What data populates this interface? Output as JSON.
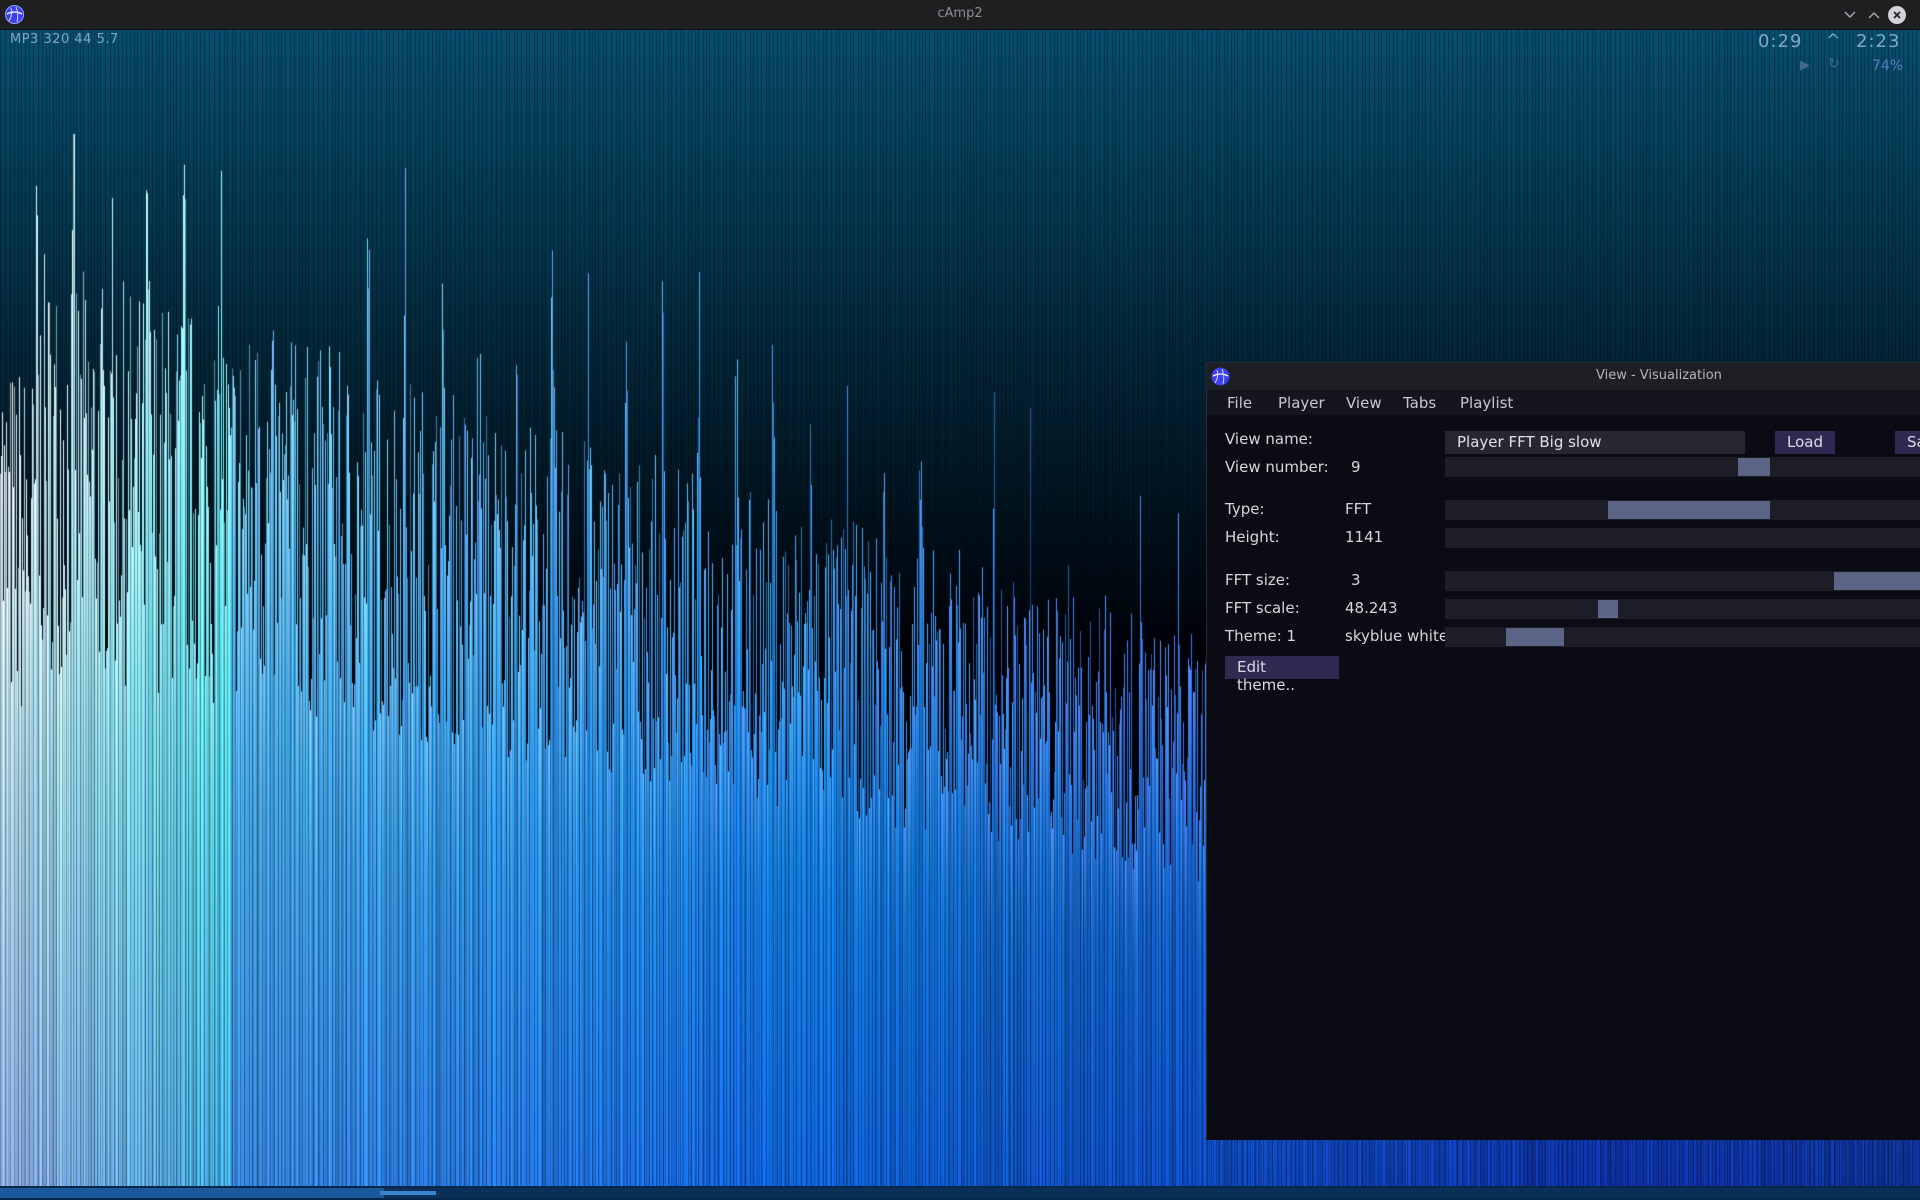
{
  "window": {
    "title": "cAmp2",
    "controls": {
      "minimize": "chevron-down",
      "maximize": "chevron-up",
      "close": "close-x"
    }
  },
  "player": {
    "format_info": "MP3 320 44  5.7",
    "time_current": "0:29",
    "time_separator": "^",
    "time_total": "2:23",
    "volume": "74%",
    "playback_progress": 0.2,
    "icons": {
      "play": "play-icon",
      "repeat": "repeat-icon"
    }
  },
  "visualization": {
    "type": "FFT spectrum",
    "colors": {
      "bright": "#e8ffff",
      "mid": "#2f9ef2",
      "dark": "#0a3f9e",
      "bg_top": "#07506f",
      "bg_bottom": "#000005"
    }
  },
  "view_window": {
    "title": "View - Visualization",
    "menu": [
      "File",
      "Player",
      "View",
      "Tabs",
      "Playlist"
    ],
    "fields": {
      "view_name_label": "View name:",
      "view_name_value": "Player FFT Big slow",
      "load_label": "Load",
      "save_label": "Sa",
      "view_number_label": "View number:",
      "view_number_value": "9",
      "type_label": "Type:",
      "type_value": "FFT",
      "height_label": "Height:",
      "height_value": "1141",
      "fft_size_label": "FFT size:",
      "fft_size_value": "3",
      "fft_scale_label": "FFT scale:",
      "fft_scale_value": "48.243",
      "theme_label": "Theme:  1",
      "theme_value": "skyblue white",
      "edit_theme_label": "Edit theme.."
    }
  }
}
